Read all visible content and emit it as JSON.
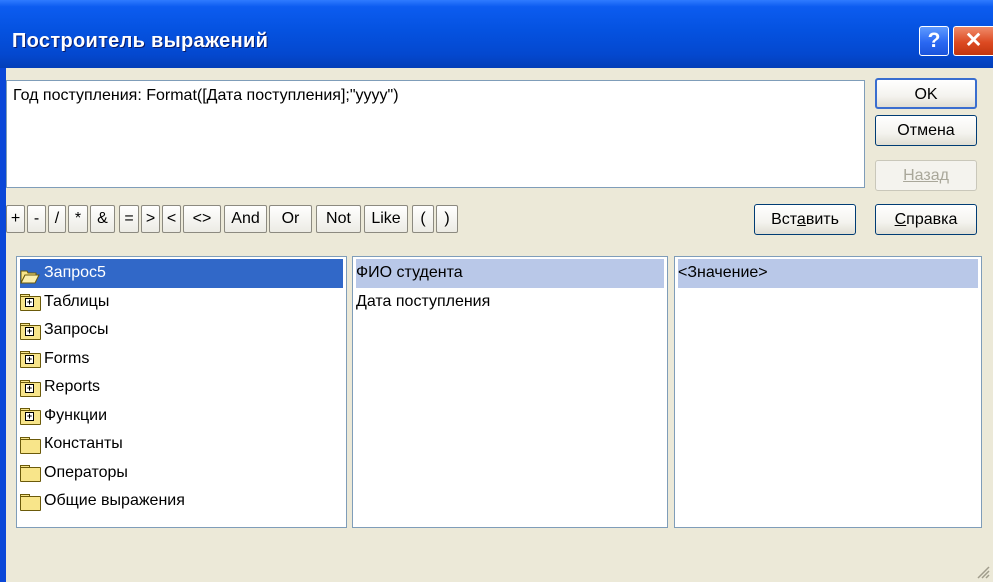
{
  "window": {
    "title": "Построитель выражений"
  },
  "titlebar": {
    "help_glyph": "?",
    "close_glyph": "✕"
  },
  "expression": {
    "value": "Год поступления: Format([Дата поступления];\"yyyy\")"
  },
  "buttons": {
    "ok": "OK",
    "cancel": "Отмена",
    "back": "Назад",
    "insert_pre": "Вст",
    "insert_u": "а",
    "insert_post": "вить",
    "help_pre": "",
    "help_u": "С",
    "help_post": "правка"
  },
  "operators": [
    "+",
    "-",
    "/",
    "*",
    "&",
    "=",
    ">",
    "<",
    "<>",
    "And",
    "Or",
    "Not",
    "Like",
    "(",
    ")"
  ],
  "list1": {
    "items": [
      {
        "label": "Запрос5",
        "icon": "open-folder-icon",
        "selected": true
      },
      {
        "label": "Таблицы",
        "icon": "plus-folder-icon"
      },
      {
        "label": "Запросы",
        "icon": "plus-folder-icon"
      },
      {
        "label": "Forms",
        "icon": "plus-folder-icon"
      },
      {
        "label": "Reports",
        "icon": "plus-folder-icon"
      },
      {
        "label": "Функции",
        "icon": "plus-folder-icon"
      },
      {
        "label": "Константы",
        "icon": "folder-icon"
      },
      {
        "label": "Операторы",
        "icon": "folder-icon"
      },
      {
        "label": "Общие выражения",
        "icon": "folder-icon"
      }
    ]
  },
  "list2": {
    "items": [
      "ФИО студента",
      "Дата поступления"
    ]
  },
  "list3": {
    "items": [
      "<Значение>"
    ]
  },
  "colors": {
    "title_bg": "#0552e0",
    "selection": "#3168c8",
    "inactive_selection": "#b9c8e8",
    "face": "#ece9d8"
  }
}
